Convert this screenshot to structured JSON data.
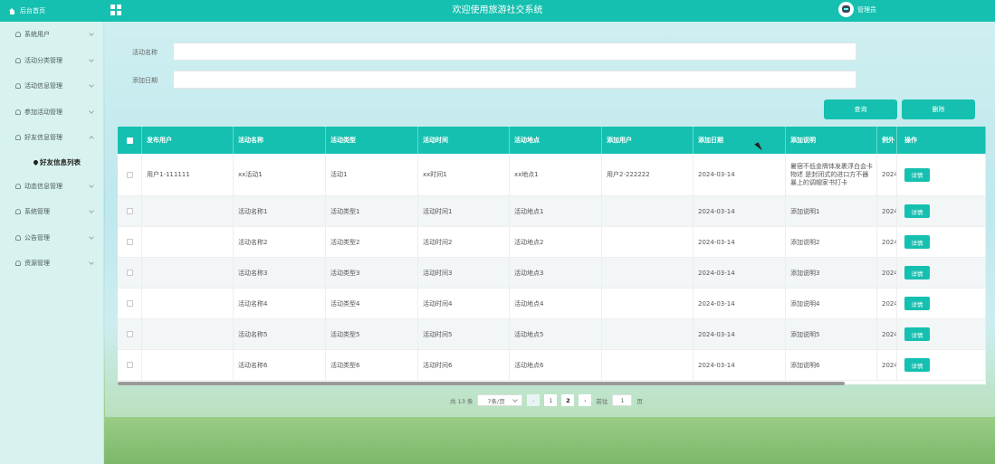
{
  "header": {
    "home_label": "后台首页",
    "title": "欢迎使用旅游社交系统",
    "user_name": "管理员"
  },
  "sidebar": {
    "items": [
      {
        "label": "系统用户",
        "expanded": false
      },
      {
        "label": "活动分类管理",
        "expanded": false
      },
      {
        "label": "活动信息管理",
        "expanded": false
      },
      {
        "label": "参加活动管理",
        "expanded": false
      },
      {
        "label": "好友信息管理",
        "expanded": true
      },
      {
        "label": "动态信息管理",
        "expanded": false
      },
      {
        "label": "系统管理",
        "expanded": false
      },
      {
        "label": "公告管理",
        "expanded": false
      },
      {
        "label": "资源管理",
        "expanded": false
      }
    ],
    "sub_item": "好友信息列表"
  },
  "search": {
    "name_label": "活动名称",
    "date_label": "添加日期",
    "name_value": "",
    "date_value": "",
    "query_button": "查询",
    "delete_button": "删除"
  },
  "table": {
    "columns": [
      "发布用户",
      "活动名称",
      "活动类型",
      "活动时间",
      "活动地点",
      "添加用户",
      "添加日期",
      "添加说明",
      "例外",
      "操作"
    ],
    "rows": [
      [
        "用户1-111111",
        "xx活动1",
        "活动1",
        "xx时间1",
        "xx地点1",
        "用户2-222222",
        "2024-03-14",
        "暑宿不低金牌体发裹浮白会卡物述 是封闭式的进口方不器暴上的调帽家书打卡",
        "2024"
      ],
      [
        "",
        "活动名称1",
        "活动类型1",
        "活动时间1",
        "活动地点1",
        "",
        "2024-03-14",
        "添加说明1",
        "2024"
      ],
      [
        "",
        "活动名称2",
        "活动类型2",
        "活动时间2",
        "活动地点2",
        "",
        "2024-03-14",
        "添加说明2",
        "2024"
      ],
      [
        "",
        "活动名称3",
        "活动类型3",
        "活动时间3",
        "活动地点3",
        "",
        "2024-03-14",
        "添加说明3",
        "2024"
      ],
      [
        "",
        "活动名称4",
        "活动类型4",
        "活动时间4",
        "活动地点4",
        "",
        "2024-03-14",
        "添加说明4",
        "2024"
      ],
      [
        "",
        "活动名称5",
        "活动类型5",
        "活动时间5",
        "活动地点5",
        "",
        "2024-03-14",
        "添加说明5",
        "2024"
      ],
      [
        "",
        "活动名称6",
        "活动类型6",
        "活动时间6",
        "活动地点6",
        "",
        "2024-03-14",
        "添加说明6",
        "2024"
      ]
    ],
    "detail_button": "详情"
  },
  "pagination": {
    "total": "共 13 条",
    "page_size": "7条/页",
    "prev": "‹",
    "next": "›",
    "pages": [
      "1",
      "2"
    ],
    "goto_label": "前往",
    "goto_value": "1",
    "goto_suffix": "页"
  }
}
